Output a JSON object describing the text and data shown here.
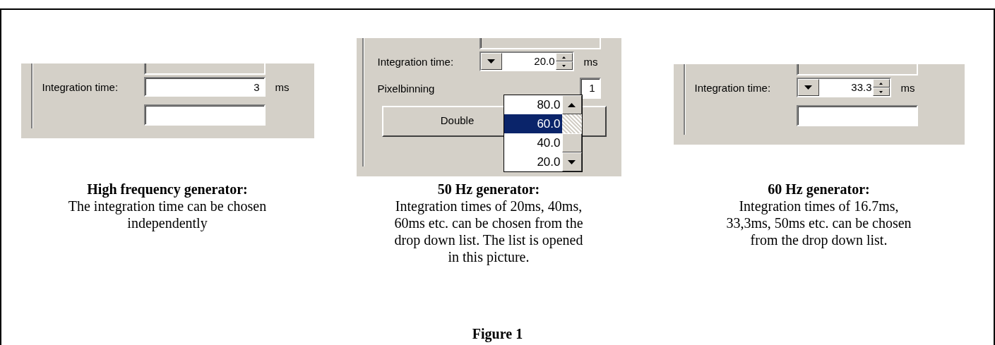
{
  "panels": [
    {
      "kind": "edit",
      "integration_label": "Integration time:",
      "value": "3",
      "unit": "ms",
      "caption_title": "High frequency generator:",
      "caption_text": "The integration time can be chosen independently"
    },
    {
      "kind": "combo",
      "integration_label": "Integration time:",
      "value": "20.0",
      "unit": "ms",
      "pixelbinning_label": "Pixelbinning",
      "pixelbinning_value": "1",
      "button": "Double",
      "dropdown": {
        "options": [
          {
            "label": "80.0",
            "selected": false
          },
          {
            "label": "60.0",
            "selected": true
          },
          {
            "label": "40.0",
            "selected": false
          },
          {
            "label": "20.0",
            "selected": false
          }
        ]
      },
      "caption_title": "50 Hz generator:",
      "caption_text": "Integration times of 20ms, 40ms, 60ms etc. can be chosen from the drop down list. The list is opened in this picture."
    },
    {
      "kind": "combo",
      "integration_label": "Integration time:",
      "value": "33.3",
      "unit": "ms",
      "caption_title": "60 Hz generator:",
      "caption_text": "Integration times of 16.7ms, 33,3ms, 50ms etc. can be chosen from the drop down list."
    }
  ],
  "figure_title": "Figure 1"
}
